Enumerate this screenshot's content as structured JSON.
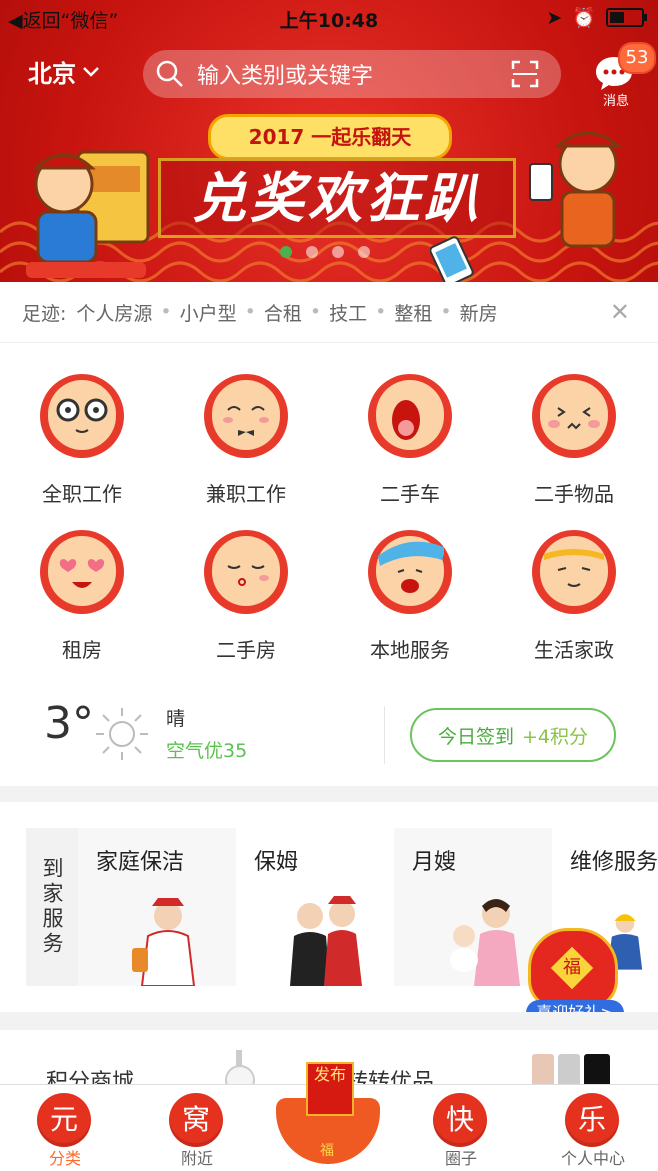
{
  "status_bar": {
    "back_label": "返回“微信”",
    "time": "上午10:48"
  },
  "header": {
    "city": "北京",
    "search_placeholder": "输入类别或关键字",
    "messages_label": "消息",
    "messages_count": "53"
  },
  "banner": {
    "subtitle": "2017 一起乐翻天",
    "title": "兑奖欢狂趴",
    "slide_count": 4,
    "active_slide": 1
  },
  "footprint": {
    "label": "足迹:",
    "items": [
      "个人房源",
      "小户型",
      "合租",
      "技工",
      "整租",
      "新房"
    ]
  },
  "categories": [
    {
      "label": "全职工作"
    },
    {
      "label": "兼职工作"
    },
    {
      "label": "二手车"
    },
    {
      "label": "二手物品"
    },
    {
      "label": "租房"
    },
    {
      "label": "二手房"
    },
    {
      "label": "本地服务"
    },
    {
      "label": "生活家政"
    }
  ],
  "weather": {
    "temperature": "3°",
    "condition": "晴",
    "air_quality": "空气优35",
    "signin_label": "今日签到",
    "signin_points": "+4积分"
  },
  "home_services": {
    "section_label": "到家服务",
    "items": [
      {
        "name": "家庭保洁"
      },
      {
        "name": "保姆"
      },
      {
        "name": "月嫂"
      },
      {
        "name": "维修服务"
      }
    ]
  },
  "promo": {
    "label": "喜迎好礼>",
    "badge": "福"
  },
  "lower_section": {
    "left_title": "积分商城",
    "right_title": "转转优品"
  },
  "tabbar": {
    "tabs": [
      {
        "icon_char": "元",
        "label": "分类",
        "active": true
      },
      {
        "icon_char": "窝",
        "label": "附近"
      },
      {
        "icon_char": "快",
        "label": "圈子"
      },
      {
        "icon_char": "乐",
        "label": "个人中心"
      }
    ],
    "publish": {
      "label": "发布",
      "badge": "福"
    }
  },
  "colors": {
    "brand_red": "#c8140f",
    "accent_green": "#5cc24f",
    "tab_active": "#ff6a2a"
  }
}
